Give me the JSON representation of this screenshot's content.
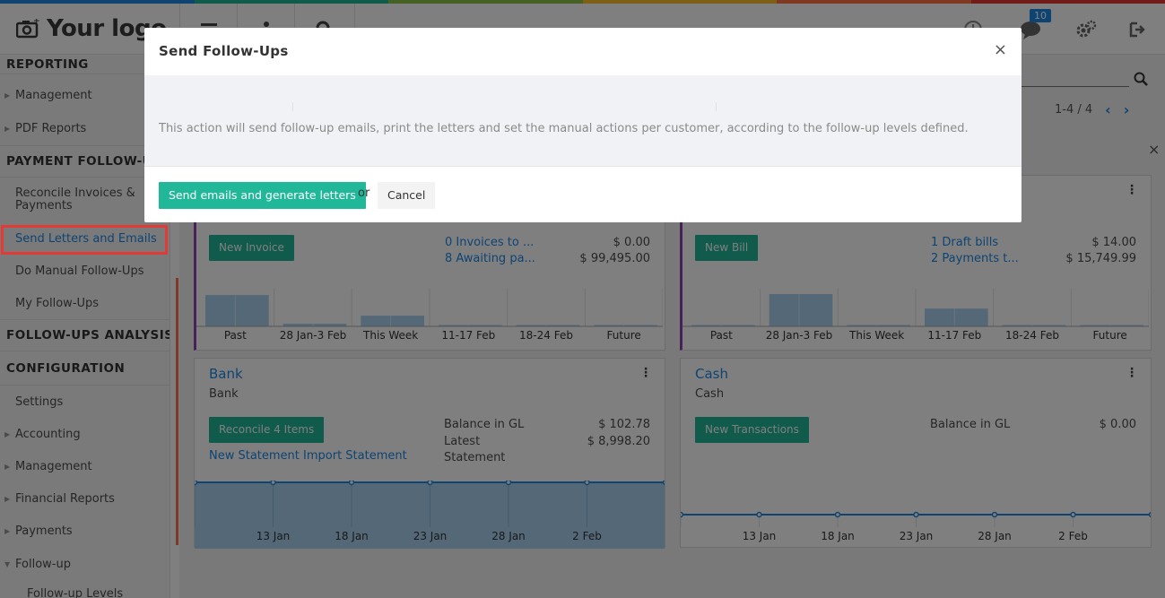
{
  "colors": {
    "colorbar": [
      "#1e88e5",
      "#21b799",
      "#8bc34a",
      "#fbc02d",
      "#ff7043",
      "#e53935"
    ],
    "accent": "#1e88e5",
    "button_green": "#21b799",
    "highlight_red": "#e53935",
    "graph_fill": "#a8d1f0"
  },
  "header": {
    "logo_text": "Your logo",
    "notification_count": "10",
    "icons": [
      "camera-icon",
      "menu-icon",
      "user-icon",
      "search-icon",
      "clock-icon",
      "chat-icon",
      "gears-icon",
      "logout-icon"
    ]
  },
  "sidebar": {
    "reporting": "REPORTING",
    "reporting_items": [
      "Management",
      "PDF Reports"
    ],
    "payment_followup": "PAYMENT FOLLOW-UP",
    "payment_items": [
      "Reconcile Invoices &",
      "Payments",
      "Send Letters and Emails",
      "Do Manual Follow-Ups",
      "My Follow-Ups"
    ],
    "followups_analysis": "FOLLOW-UPS ANALYSIS",
    "configuration": "CONFIGURATION",
    "config_items": [
      "Settings",
      "Accounting",
      "Management",
      "Financial Reports",
      "Payments",
      "Follow-up",
      "Follow-up Levels"
    ]
  },
  "control_panel": {
    "pager": "1-4 / 4"
  },
  "cards": {
    "invoices": {
      "button": "New Invoice",
      "link1": "0 Invoices to ...",
      "link2": "8 Awaiting pa...",
      "amt1": "$ 0.00",
      "amt2": "$ 99,495.00"
    },
    "bills": {
      "button": "New Bill",
      "link1": "1 Draft bills",
      "link2": "2 Payments t...",
      "amt1": "$ 14.00",
      "amt2": "$ 15,749.99"
    },
    "bank": {
      "title": "Bank",
      "subtitle": "Bank",
      "button": "Reconcile 4 Items",
      "link": "New Statement Import Statement",
      "label1": "Balance in GL",
      "label2": "Latest",
      "label3": "Statement",
      "amt1": "$ 102.78",
      "amt2": "$ 8,998.20"
    },
    "cash": {
      "title": "Cash",
      "subtitle": "Cash",
      "button": "New Transactions",
      "label1": "Balance in GL",
      "amt1": "$ 0.00"
    }
  },
  "chart_data": [
    {
      "type": "bar",
      "categories": [
        "Past",
        "28 Jan-3 Feb",
        "This Week",
        "11-17 Feb",
        "18-24 Feb",
        "Future"
      ],
      "values": [
        0.97,
        0.08,
        0.33,
        0.02,
        0.02,
        0.02
      ]
    },
    {
      "type": "bar",
      "categories": [
        "Past",
        "28 Jan-3 Feb",
        "This Week",
        "11-17 Feb",
        "18-24 Feb",
        "Future"
      ],
      "values": [
        0.02,
        1.0,
        0.02,
        0.55,
        0.02,
        0.02
      ]
    },
    {
      "type": "area",
      "x": [
        "13 Jan",
        "18 Jan",
        "23 Jan",
        "28 Jan",
        "2 Feb"
      ]
    },
    {
      "type": "line",
      "x": [
        "13 Jan",
        "18 Jan",
        "23 Jan",
        "28 Jan",
        "2 Feb"
      ]
    }
  ],
  "modal": {
    "title": "Send Follow-Ups",
    "close": "×",
    "message": "This action will send follow-up emails, print the letters and set the manual actions per customer, according to the follow-up levels defined.",
    "primary_button": "Send emails and generate letters",
    "or": "or",
    "cancel_button": "Cancel"
  }
}
